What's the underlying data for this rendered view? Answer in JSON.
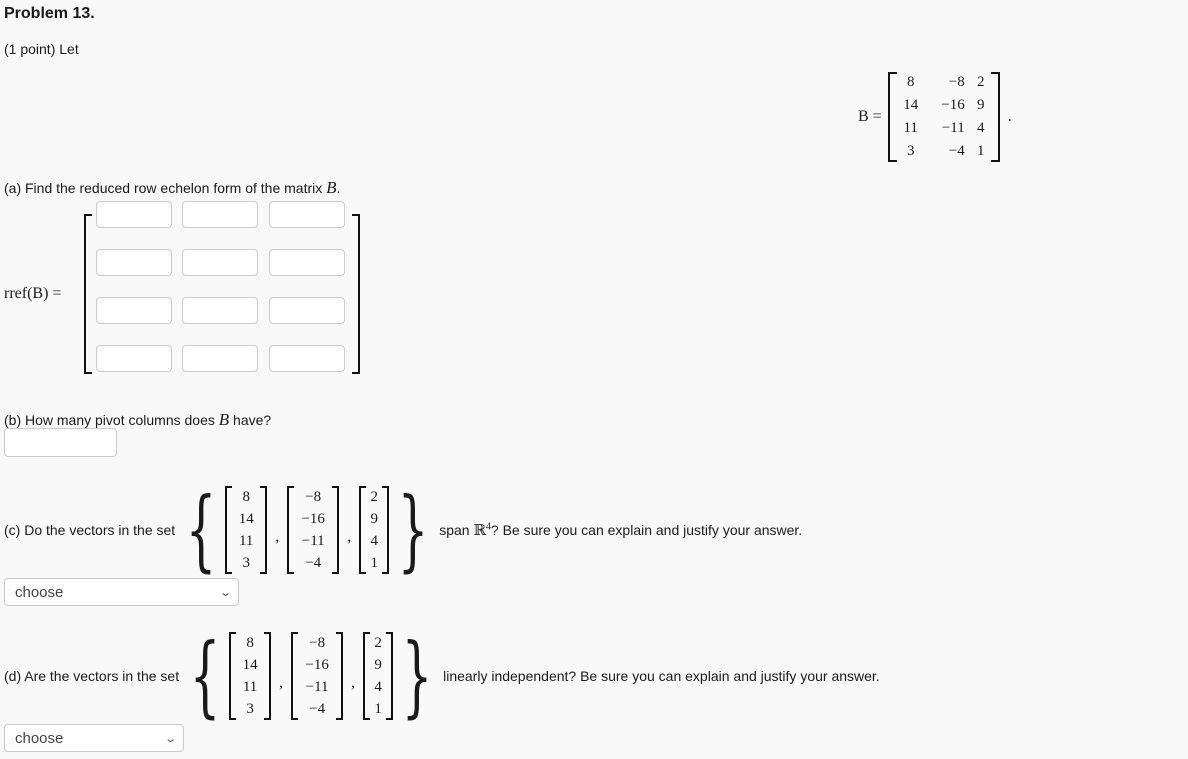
{
  "problem": {
    "title": "Problem 13.",
    "intro": "(1 point) Let"
  },
  "matrix_b": {
    "label": "B =",
    "rows": [
      [
        "8",
        "−8",
        "2"
      ],
      [
        "14",
        "−16",
        "9"
      ],
      [
        "11",
        "−11",
        "4"
      ],
      [
        "3",
        "−4",
        "1"
      ]
    ],
    "terminator": "."
  },
  "part_a": {
    "prompt": "(a) Find the reduced row echelon form of the matrix",
    "prompt_var": "B",
    "prompt_end": ".",
    "rref_label": "rref(B) =",
    "cells": [
      [
        "",
        "",
        ""
      ],
      [
        "",
        "",
        ""
      ],
      [
        "",
        "",
        ""
      ],
      [
        "",
        "",
        ""
      ]
    ]
  },
  "part_b": {
    "prompt_start": "(b) How many pivot columns does",
    "prompt_var": "B",
    "prompt_end": "have?",
    "answer": ""
  },
  "part_c": {
    "prompt_start": "(c) Do the vectors in the set",
    "prompt_end_pre": "span",
    "space": "ℝ",
    "space_exp": "4",
    "prompt_end_post": "? Be sure you can explain and justify your answer.",
    "vectors": [
      [
        "8",
        "14",
        "11",
        "3"
      ],
      [
        "−8",
        "−16",
        "−11",
        "−4"
      ],
      [
        "2",
        "9",
        "4",
        "1"
      ]
    ],
    "select_value": "choose"
  },
  "part_d": {
    "prompt_start": "(d) Are the vectors in the set",
    "prompt_end": "linearly independent? Be sure you can explain and justify your answer.",
    "vectors": [
      [
        "8",
        "14",
        "11",
        "3"
      ],
      [
        "−8",
        "−16",
        "−11",
        "−4"
      ],
      [
        "2",
        "9",
        "4",
        "1"
      ]
    ],
    "select_value": "choose"
  },
  "symbols": {
    "open_brace": "{",
    "close_brace": "}",
    "comma": ",",
    "chevron": "⌄"
  }
}
